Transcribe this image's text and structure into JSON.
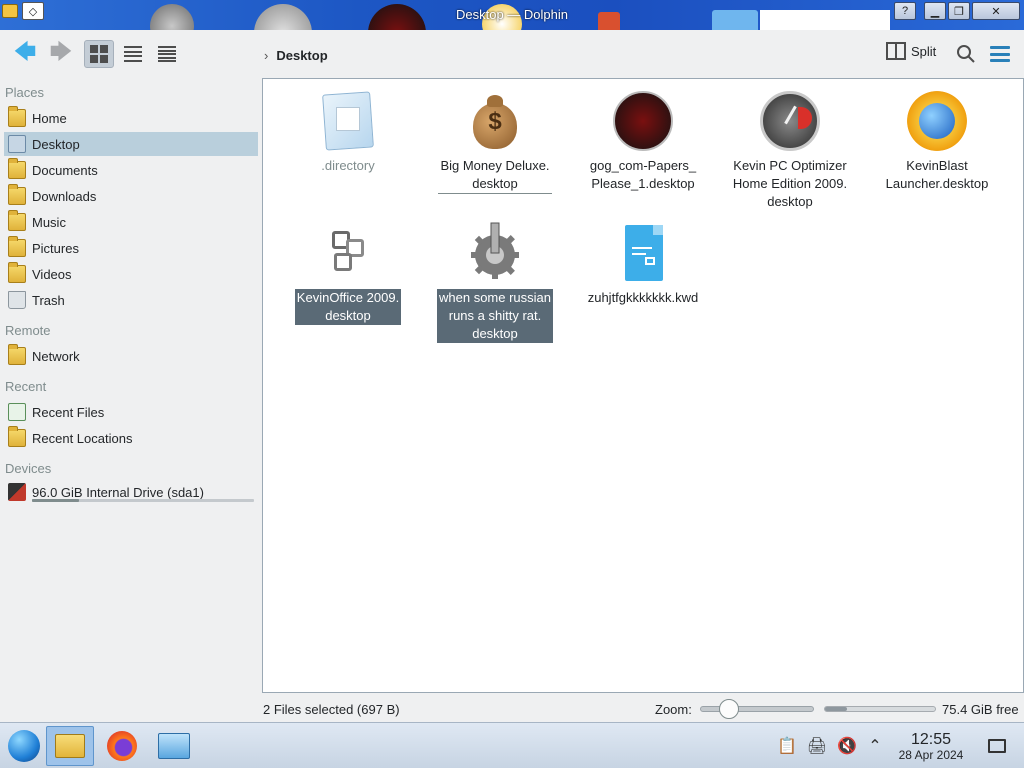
{
  "window": {
    "title": "Desktop — Dolphin"
  },
  "toolbar": {
    "breadcrumb": "Desktop",
    "split_label": "Split"
  },
  "sidebar": {
    "sections": {
      "places": "Places",
      "remote": "Remote",
      "recent": "Recent",
      "devices": "Devices"
    },
    "places": [
      {
        "label": "Home"
      },
      {
        "label": "Desktop"
      },
      {
        "label": "Documents"
      },
      {
        "label": "Downloads"
      },
      {
        "label": "Music"
      },
      {
        "label": "Pictures"
      },
      {
        "label": "Videos"
      },
      {
        "label": "Trash"
      }
    ],
    "remote": [
      {
        "label": "Network"
      }
    ],
    "recent": [
      {
        "label": "Recent Files"
      },
      {
        "label": "Recent Locations"
      }
    ],
    "devices": [
      {
        "label": "96.0 GiB Internal Drive (sda1)",
        "usage_fraction": 0.21
      }
    ]
  },
  "files": [
    {
      "name": ".directory",
      "icon": "settings-file-icon"
    },
    {
      "name": "Big Money Deluxe.\ndesktop",
      "icon": "money-bag-icon"
    },
    {
      "name": "gog_com-Papers_\nPlease_1.desktop",
      "icon": "papers-please-icon"
    },
    {
      "name": "Kevin PC Optimizer\nHome Edition 2009.\ndesktop",
      "icon": "speedometer-icon"
    },
    {
      "name": "KevinBlast\nLauncher.desktop",
      "icon": "globe-burst-icon"
    },
    {
      "name": "KevinOffice 2009.\ndesktop",
      "icon": "office-icon"
    },
    {
      "name": "when some russian\nruns a shitty rat.\ndesktop",
      "icon": "gear-icon"
    },
    {
      "name": "zuhjtfgkkkkkkk.kwd",
      "icon": "document-icon"
    }
  ],
  "statusbar": {
    "selection": "2 Files selected (697 B)",
    "zoom_label": "Zoom:",
    "zoom_fraction": 0.25,
    "free_fraction": 0.2,
    "free_text": "75.4 GiB free"
  },
  "clock": {
    "time": "12:55",
    "date": "28 Apr 2024"
  },
  "colors": {
    "accent": "#3daee9",
    "selection": "#b9cfdc",
    "file_selected": "#5a6a76"
  }
}
